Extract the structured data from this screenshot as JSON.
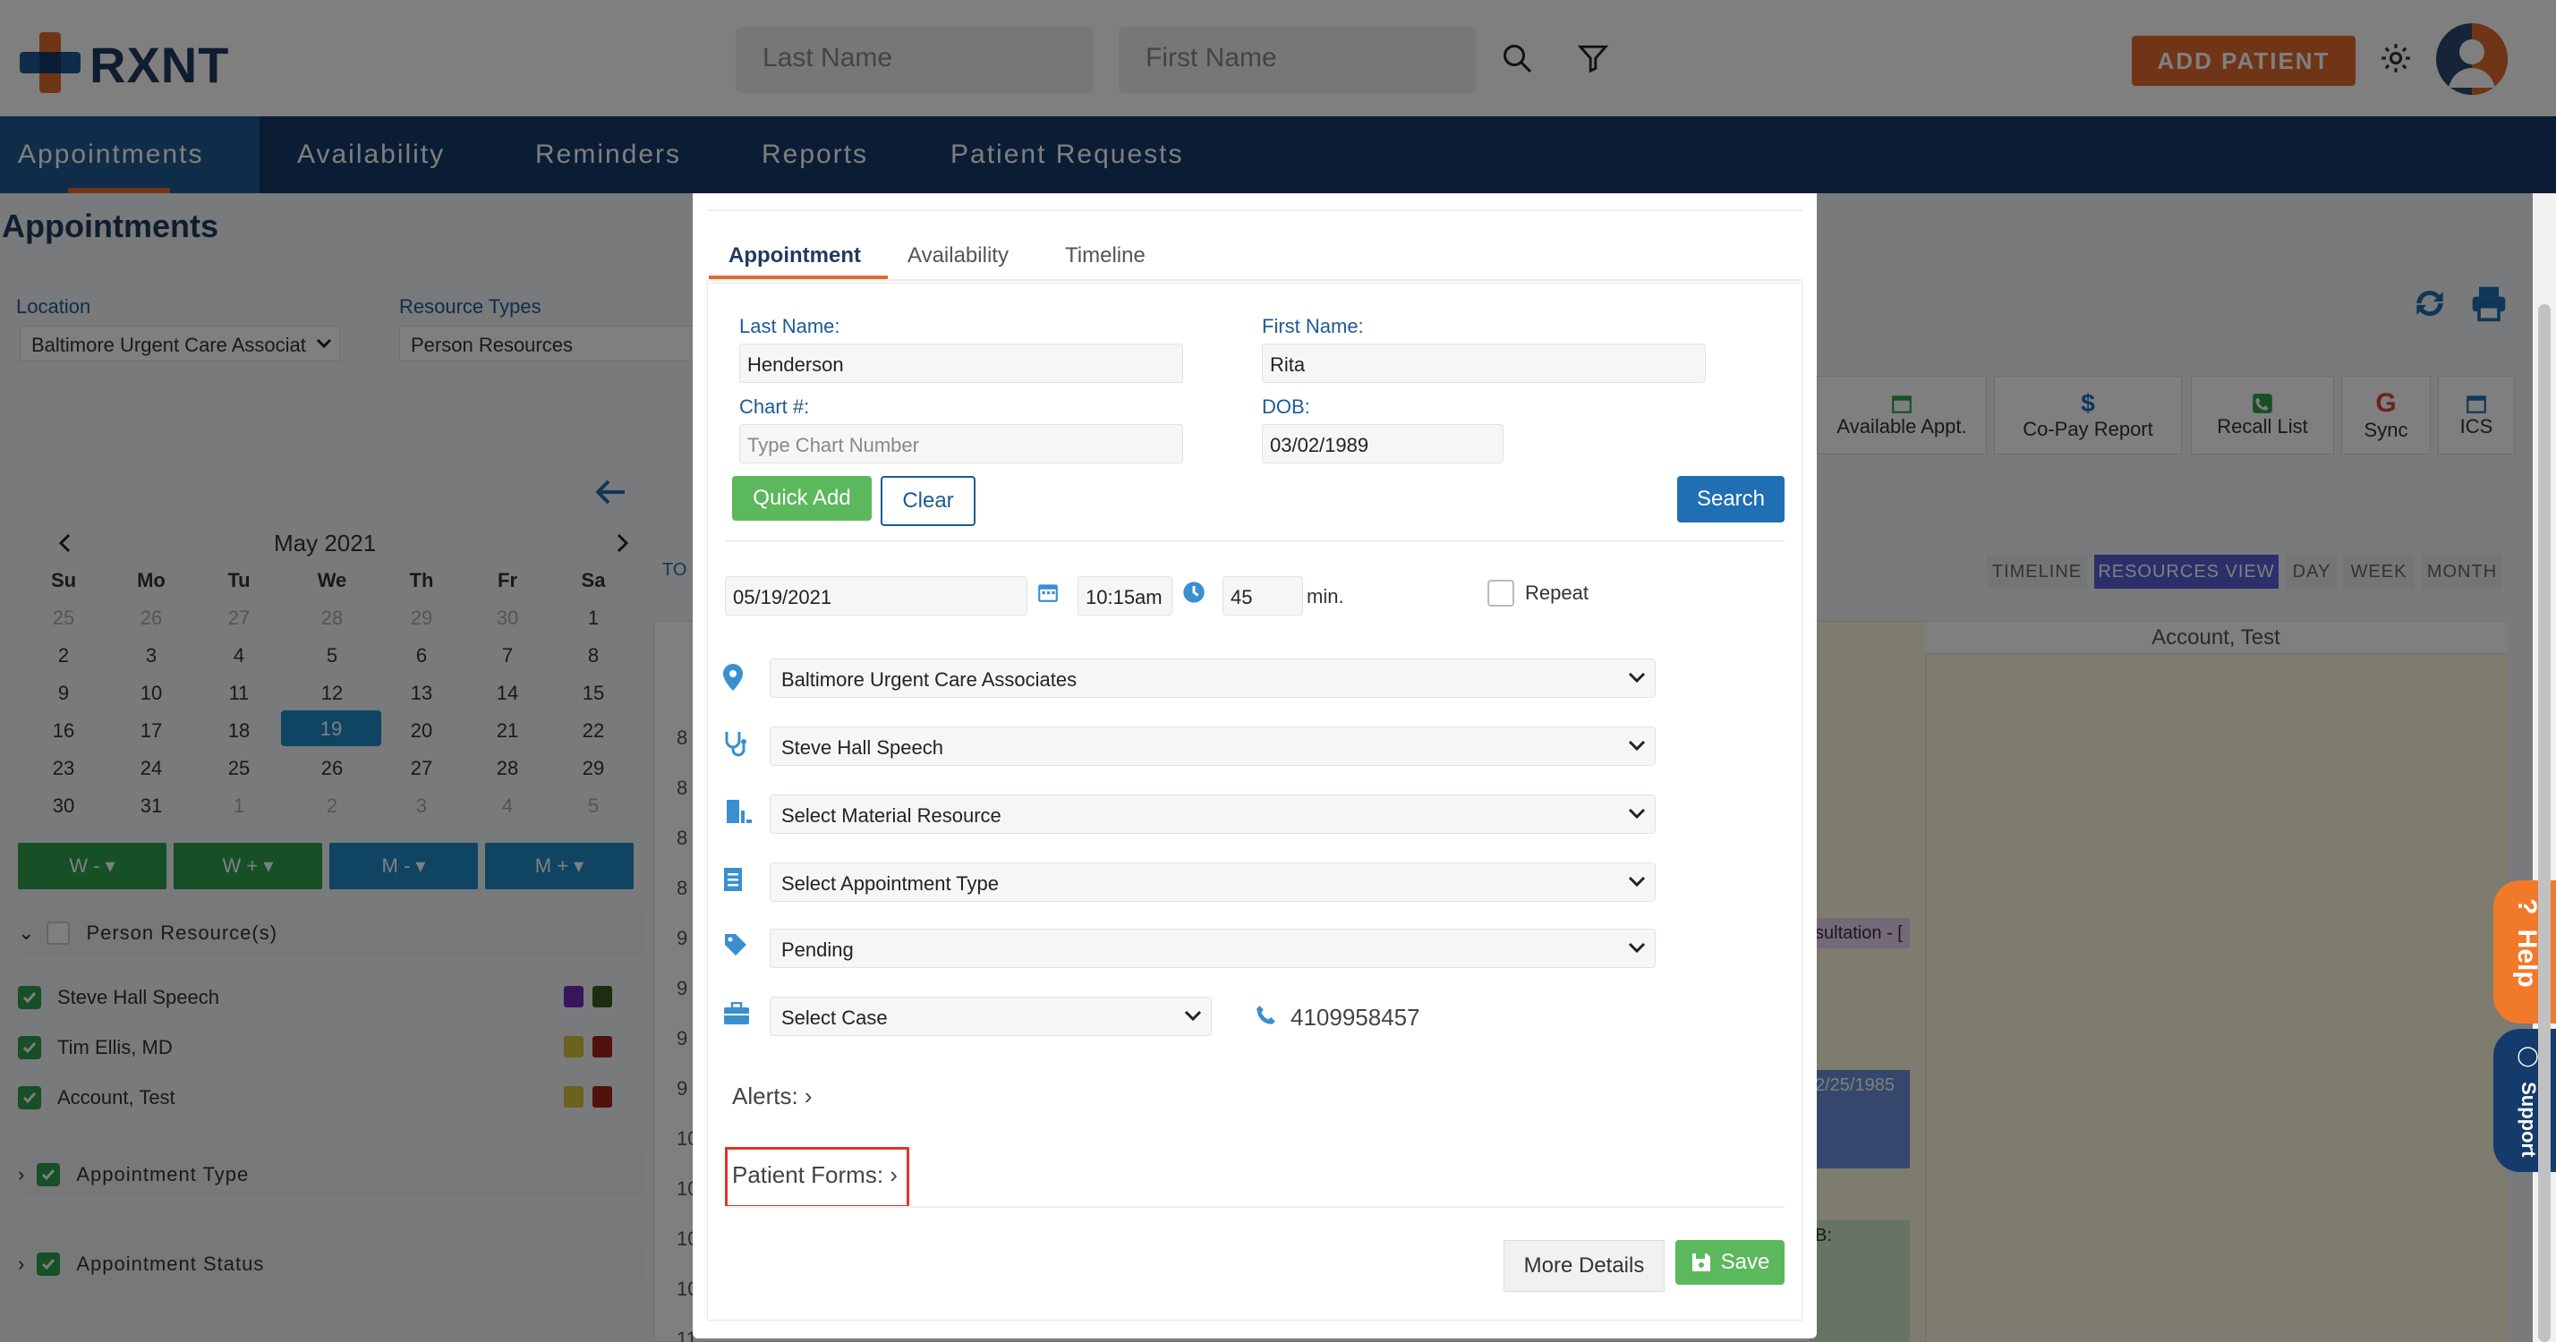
{
  "header": {
    "logo_text": "RXNT",
    "last_name_placeholder": "Last Name",
    "first_name_placeholder": "First Name",
    "add_patient_label": "ADD PATIENT"
  },
  "nav": {
    "items": [
      "Appointments",
      "Availability",
      "Reminders",
      "Reports",
      "Patient Requests"
    ],
    "active": "Appointments"
  },
  "page": {
    "title": "Appointments",
    "location_label": "Location",
    "location_value": "Baltimore Urgent Care Associat",
    "resource_types_label": "Resource Types",
    "resource_types_value": "Person Resources"
  },
  "calendar": {
    "month_label": "May 2021",
    "weekdays": [
      "Su",
      "Mo",
      "Tu",
      "We",
      "Th",
      "Fr",
      "Sa"
    ],
    "weeks": [
      [
        "25",
        "26",
        "27",
        "28",
        "29",
        "30",
        "1"
      ],
      [
        "2",
        "3",
        "4",
        "5",
        "6",
        "7",
        "8"
      ],
      [
        "9",
        "10",
        "11",
        "12",
        "13",
        "14",
        "15"
      ],
      [
        "16",
        "17",
        "18",
        "19",
        "20",
        "21",
        "22"
      ],
      [
        "23",
        "24",
        "25",
        "26",
        "27",
        "28",
        "29"
      ],
      [
        "30",
        "31",
        "1",
        "2",
        "3",
        "4",
        "5"
      ]
    ],
    "selected_day": "19",
    "nav_buttons": [
      "W -",
      "W +",
      "M -",
      "M +"
    ]
  },
  "sidebar": {
    "person_resources_label": "Person Resource(s)",
    "resources": [
      {
        "name": "Steve Hall Speech",
        "colors": [
          "#6f2db8",
          "#3c5a1e"
        ]
      },
      {
        "name": "Tim Ellis, MD",
        "colors": [
          "#d8c23a",
          "#a3241f"
        ]
      },
      {
        "name": "Account, Test",
        "colors": [
          "#d8c23a",
          "#a3241f"
        ]
      }
    ],
    "appointment_type_label": "Appointment Type",
    "appointment_status_label": "Appointment Status"
  },
  "toolbar": {
    "buttons": [
      {
        "label": "Available Appt.",
        "icon": "calendar-icon",
        "color": "#2e9e4f"
      },
      {
        "label": "Co-Pay Report",
        "icon": "dollar-icon",
        "color": "#1f6fb2"
      },
      {
        "label": "Recall List",
        "icon": "phone-icon",
        "color": "#2e9e4f"
      },
      {
        "label": "Sync",
        "icon": "google-icon",
        "color": "#db4437"
      },
      {
        "label": "ICS",
        "icon": "calendar-icon",
        "color": "#1f6fb2"
      }
    ],
    "views": [
      "TIMELINE",
      "RESOURCES VIEW",
      "DAY",
      "WEEK",
      "MONTH"
    ],
    "active_view": "RESOURCES VIEW",
    "today_label": "TO"
  },
  "schedule": {
    "column_header": "Account, Test",
    "row_labels": [
      "8",
      "8",
      "8",
      "8",
      "9",
      "9",
      "9",
      "9",
      "10",
      "10",
      "10",
      "10",
      "11"
    ],
    "events": [
      "sultation - [",
      "2/25/1985",
      "B:"
    ]
  },
  "modal": {
    "tabs": [
      "Appointment",
      "Availability",
      "Timeline"
    ],
    "active_tab": "Appointment",
    "last_name_label": "Last Name:",
    "last_name_value": "Henderson",
    "first_name_label": "First Name:",
    "first_name_value": "Rita",
    "chart_label": "Chart #:",
    "chart_placeholder": "Type Chart Number",
    "dob_label": "DOB:",
    "dob_value": "03/02/1989",
    "quick_add_label": "Quick Add",
    "clear_label": "Clear",
    "search_label": "Search",
    "date_value": "05/19/2021",
    "time_value": "10:15am",
    "duration_value": "45",
    "duration_unit": "min.",
    "repeat_label": "Repeat",
    "location_value": "Baltimore Urgent Care Associates",
    "provider_value": "Steve Hall Speech",
    "material_value": "Select Material Resource",
    "appt_type_value": "Select Appointment Type",
    "status_value": "Pending",
    "case_value": "Select Case",
    "phone_value": "4109958457",
    "alerts_label": "Alerts:",
    "patient_forms_label": "Patient Forms:",
    "more_details_label": "More Details",
    "save_label": "Save",
    "highlight_color": "#e0352b"
  },
  "side_tabs": {
    "help_label": "Help",
    "support_label": "Support"
  }
}
